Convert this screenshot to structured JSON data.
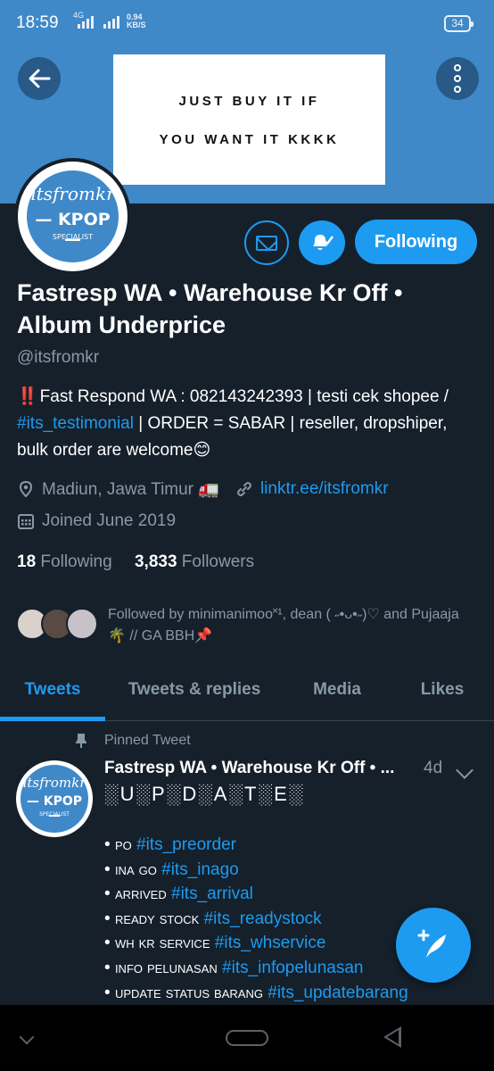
{
  "status_bar": {
    "time": "18:59",
    "network": "4G",
    "speed_value": "0.94",
    "speed_unit": "KB/S",
    "battery": "34"
  },
  "banner": {
    "line1": "JUST BUY IT IF",
    "line2": "YOU WANT IT KKKK",
    "background": "#3f89c9"
  },
  "avatar_logo": {
    "line1": "itsfromkr",
    "line2": "— KPOP —",
    "line3": "SPECIALIST"
  },
  "actions": {
    "follow_label": "Following",
    "message_icon": "mail-icon",
    "notify_icon": "bell-check-icon"
  },
  "profile": {
    "name": "Fastresp WA • Warehouse Kr Off • Album Underprice",
    "handle": "@itsfromkr",
    "bio_bang": "‼️",
    "bio_part1": "Fast Respond WA : 082143242393 | testi cek shopee / ",
    "bio_hashtag": "#its_testimonial",
    "bio_part2": " | ORDER = SABAR | reseller, dropshiper, bulk order are welcome😊",
    "location": "Madiun, Jawa Timur 🚛",
    "website": "linktr.ee/itsfromkr",
    "joined": "Joined June 2019",
    "following_count": "18",
    "following_label": "Following",
    "followers_count": "3,833",
    "followers_label": "Followers",
    "followed_by": "Followed by minimanimoo˟¹, dean ( ˶•ᴗ•˶)♡ and Pujaaja🌴 // GA BBH📌"
  },
  "tabs": [
    {
      "label": "Tweets",
      "active": true
    },
    {
      "label": "Tweets & replies",
      "active": false
    },
    {
      "label": "Media",
      "active": false
    },
    {
      "label": "Likes",
      "active": false
    }
  ],
  "pinned_tweet": {
    "pinned_label": "Pinned Tweet",
    "author": "Fastresp WA • Warehouse Kr Off • ...",
    "time": "4d",
    "headline": "░U░P░D░A░T░E░",
    "items": [
      {
        "keyword": "PO",
        "hashtag": "#its_preorder"
      },
      {
        "keyword": "INA GO",
        "hashtag": "#its_inago"
      },
      {
        "keyword": "ARRIVED",
        "hashtag": "#its_arrival"
      },
      {
        "keyword": "READY STOCK",
        "hashtag": "#its_readystock"
      },
      {
        "keyword": "WH KR SERVICE",
        "hashtag": "#its_whservice"
      },
      {
        "keyword": "INFO PELUNASAN",
        "hashtag": "#its_infopelunasan"
      },
      {
        "keyword": "UPDATE STATUS BARANG",
        "hashtag": "#its_updatebarang"
      }
    ]
  },
  "colors": {
    "background": "#15202b",
    "accent": "#1d9bf0",
    "secondary_text": "#8899a6"
  }
}
